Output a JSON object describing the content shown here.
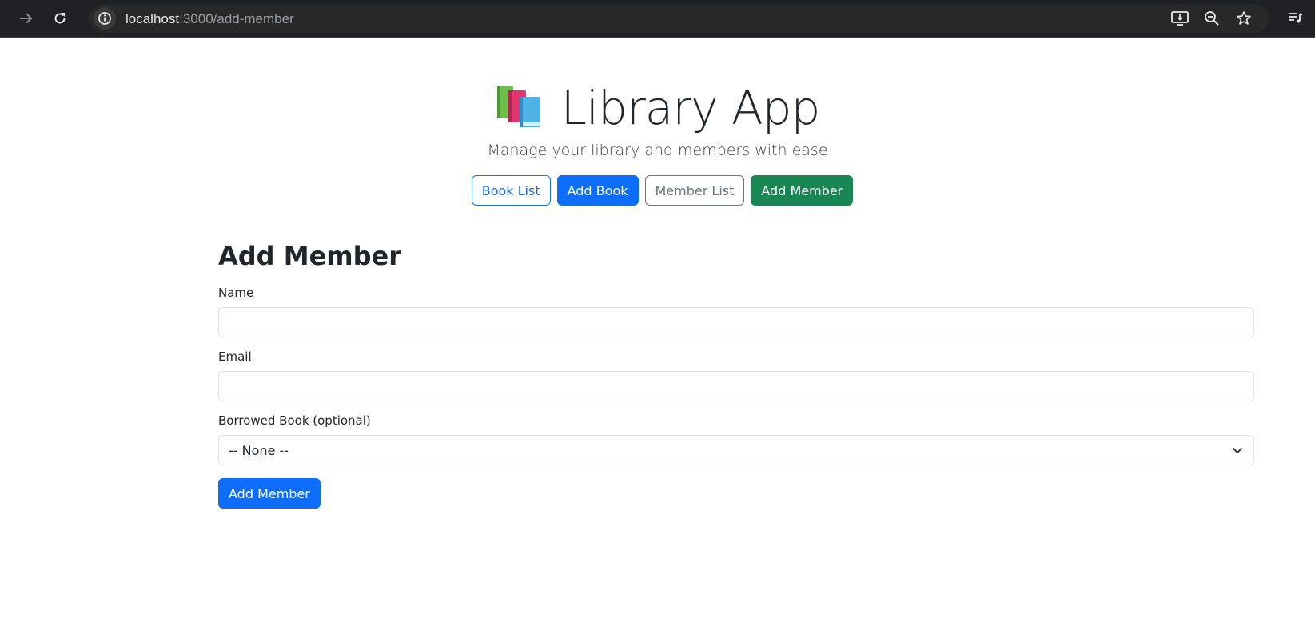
{
  "browser": {
    "url_host": "localhost",
    "url_rest": ":3000/add-member"
  },
  "header": {
    "logo_icon": "books-icon",
    "title": "Library App",
    "subtitle": "Manage your library and members with ease"
  },
  "nav": {
    "book_list": "Book List",
    "add_book": "Add Book",
    "member_list": "Member List",
    "add_member": "Add Member"
  },
  "form": {
    "title": "Add Member",
    "name_label": "Name",
    "name_value": "",
    "email_label": "Email",
    "email_value": "",
    "borrowed_label": "Borrowed Book (optional)",
    "borrowed_selected": "-- None --",
    "submit_label": "Add Member"
  },
  "colors": {
    "primary": "#0d6efd",
    "success": "#198754",
    "secondary": "#6c757d"
  }
}
